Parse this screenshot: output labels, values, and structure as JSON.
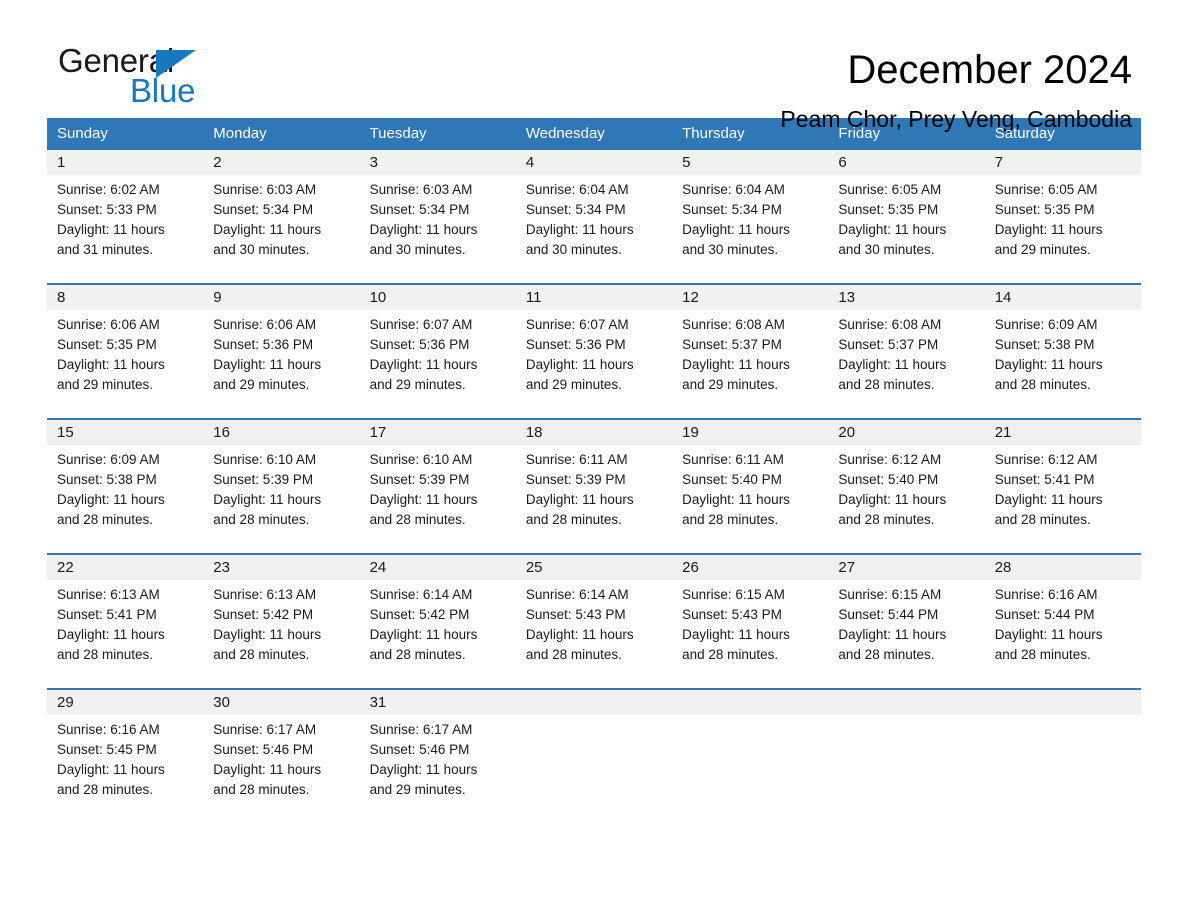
{
  "brand": {
    "name_part1": "General",
    "name_part2": "Blue",
    "accent_color": "#1878bd"
  },
  "header": {
    "title": "December 2024",
    "subtitle": "Peam Chor, Prey Veng, Cambodia"
  },
  "calendar": {
    "header_color": "#3077b5",
    "daynum_bg": "#f1f1f1",
    "weekdays": [
      "Sunday",
      "Monday",
      "Tuesday",
      "Wednesday",
      "Thursday",
      "Friday",
      "Saturday"
    ],
    "weeks": [
      {
        "days": [
          {
            "num": "1",
            "sunrise": "Sunrise: 6:02 AM",
            "sunset": "Sunset: 5:33 PM",
            "daylight_l1": "Daylight: 11 hours",
            "daylight_l2": "and 31 minutes."
          },
          {
            "num": "2",
            "sunrise": "Sunrise: 6:03 AM",
            "sunset": "Sunset: 5:34 PM",
            "daylight_l1": "Daylight: 11 hours",
            "daylight_l2": "and 30 minutes."
          },
          {
            "num": "3",
            "sunrise": "Sunrise: 6:03 AM",
            "sunset": "Sunset: 5:34 PM",
            "daylight_l1": "Daylight: 11 hours",
            "daylight_l2": "and 30 minutes."
          },
          {
            "num": "4",
            "sunrise": "Sunrise: 6:04 AM",
            "sunset": "Sunset: 5:34 PM",
            "daylight_l1": "Daylight: 11 hours",
            "daylight_l2": "and 30 minutes."
          },
          {
            "num": "5",
            "sunrise": "Sunrise: 6:04 AM",
            "sunset": "Sunset: 5:34 PM",
            "daylight_l1": "Daylight: 11 hours",
            "daylight_l2": "and 30 minutes."
          },
          {
            "num": "6",
            "sunrise": "Sunrise: 6:05 AM",
            "sunset": "Sunset: 5:35 PM",
            "daylight_l1": "Daylight: 11 hours",
            "daylight_l2": "and 30 minutes."
          },
          {
            "num": "7",
            "sunrise": "Sunrise: 6:05 AM",
            "sunset": "Sunset: 5:35 PM",
            "daylight_l1": "Daylight: 11 hours",
            "daylight_l2": "and 29 minutes."
          }
        ]
      },
      {
        "days": [
          {
            "num": "8",
            "sunrise": "Sunrise: 6:06 AM",
            "sunset": "Sunset: 5:35 PM",
            "daylight_l1": "Daylight: 11 hours",
            "daylight_l2": "and 29 minutes."
          },
          {
            "num": "9",
            "sunrise": "Sunrise: 6:06 AM",
            "sunset": "Sunset: 5:36 PM",
            "daylight_l1": "Daylight: 11 hours",
            "daylight_l2": "and 29 minutes."
          },
          {
            "num": "10",
            "sunrise": "Sunrise: 6:07 AM",
            "sunset": "Sunset: 5:36 PM",
            "daylight_l1": "Daylight: 11 hours",
            "daylight_l2": "and 29 minutes."
          },
          {
            "num": "11",
            "sunrise": "Sunrise: 6:07 AM",
            "sunset": "Sunset: 5:36 PM",
            "daylight_l1": "Daylight: 11 hours",
            "daylight_l2": "and 29 minutes."
          },
          {
            "num": "12",
            "sunrise": "Sunrise: 6:08 AM",
            "sunset": "Sunset: 5:37 PM",
            "daylight_l1": "Daylight: 11 hours",
            "daylight_l2": "and 29 minutes."
          },
          {
            "num": "13",
            "sunrise": "Sunrise: 6:08 AM",
            "sunset": "Sunset: 5:37 PM",
            "daylight_l1": "Daylight: 11 hours",
            "daylight_l2": "and 28 minutes."
          },
          {
            "num": "14",
            "sunrise": "Sunrise: 6:09 AM",
            "sunset": "Sunset: 5:38 PM",
            "daylight_l1": "Daylight: 11 hours",
            "daylight_l2": "and 28 minutes."
          }
        ]
      },
      {
        "days": [
          {
            "num": "15",
            "sunrise": "Sunrise: 6:09 AM",
            "sunset": "Sunset: 5:38 PM",
            "daylight_l1": "Daylight: 11 hours",
            "daylight_l2": "and 28 minutes."
          },
          {
            "num": "16",
            "sunrise": "Sunrise: 6:10 AM",
            "sunset": "Sunset: 5:39 PM",
            "daylight_l1": "Daylight: 11 hours",
            "daylight_l2": "and 28 minutes."
          },
          {
            "num": "17",
            "sunrise": "Sunrise: 6:10 AM",
            "sunset": "Sunset: 5:39 PM",
            "daylight_l1": "Daylight: 11 hours",
            "daylight_l2": "and 28 minutes."
          },
          {
            "num": "18",
            "sunrise": "Sunrise: 6:11 AM",
            "sunset": "Sunset: 5:39 PM",
            "daylight_l1": "Daylight: 11 hours",
            "daylight_l2": "and 28 minutes."
          },
          {
            "num": "19",
            "sunrise": "Sunrise: 6:11 AM",
            "sunset": "Sunset: 5:40 PM",
            "daylight_l1": "Daylight: 11 hours",
            "daylight_l2": "and 28 minutes."
          },
          {
            "num": "20",
            "sunrise": "Sunrise: 6:12 AM",
            "sunset": "Sunset: 5:40 PM",
            "daylight_l1": "Daylight: 11 hours",
            "daylight_l2": "and 28 minutes."
          },
          {
            "num": "21",
            "sunrise": "Sunrise: 6:12 AM",
            "sunset": "Sunset: 5:41 PM",
            "daylight_l1": "Daylight: 11 hours",
            "daylight_l2": "and 28 minutes."
          }
        ]
      },
      {
        "days": [
          {
            "num": "22",
            "sunrise": "Sunrise: 6:13 AM",
            "sunset": "Sunset: 5:41 PM",
            "daylight_l1": "Daylight: 11 hours",
            "daylight_l2": "and 28 minutes."
          },
          {
            "num": "23",
            "sunrise": "Sunrise: 6:13 AM",
            "sunset": "Sunset: 5:42 PM",
            "daylight_l1": "Daylight: 11 hours",
            "daylight_l2": "and 28 minutes."
          },
          {
            "num": "24",
            "sunrise": "Sunrise: 6:14 AM",
            "sunset": "Sunset: 5:42 PM",
            "daylight_l1": "Daylight: 11 hours",
            "daylight_l2": "and 28 minutes."
          },
          {
            "num": "25",
            "sunrise": "Sunrise: 6:14 AM",
            "sunset": "Sunset: 5:43 PM",
            "daylight_l1": "Daylight: 11 hours",
            "daylight_l2": "and 28 minutes."
          },
          {
            "num": "26",
            "sunrise": "Sunrise: 6:15 AM",
            "sunset": "Sunset: 5:43 PM",
            "daylight_l1": "Daylight: 11 hours",
            "daylight_l2": "and 28 minutes."
          },
          {
            "num": "27",
            "sunrise": "Sunrise: 6:15 AM",
            "sunset": "Sunset: 5:44 PM",
            "daylight_l1": "Daylight: 11 hours",
            "daylight_l2": "and 28 minutes."
          },
          {
            "num": "28",
            "sunrise": "Sunrise: 6:16 AM",
            "sunset": "Sunset: 5:44 PM",
            "daylight_l1": "Daylight: 11 hours",
            "daylight_l2": "and 28 minutes."
          }
        ]
      },
      {
        "days": [
          {
            "num": "29",
            "sunrise": "Sunrise: 6:16 AM",
            "sunset": "Sunset: 5:45 PM",
            "daylight_l1": "Daylight: 11 hours",
            "daylight_l2": "and 28 minutes."
          },
          {
            "num": "30",
            "sunrise": "Sunrise: 6:17 AM",
            "sunset": "Sunset: 5:46 PM",
            "daylight_l1": "Daylight: 11 hours",
            "daylight_l2": "and 28 minutes."
          },
          {
            "num": "31",
            "sunrise": "Sunrise: 6:17 AM",
            "sunset": "Sunset: 5:46 PM",
            "daylight_l1": "Daylight: 11 hours",
            "daylight_l2": "and 29 minutes."
          },
          {
            "num": "",
            "sunrise": "",
            "sunset": "",
            "daylight_l1": "",
            "daylight_l2": ""
          },
          {
            "num": "",
            "sunrise": "",
            "sunset": "",
            "daylight_l1": "",
            "daylight_l2": ""
          },
          {
            "num": "",
            "sunrise": "",
            "sunset": "",
            "daylight_l1": "",
            "daylight_l2": ""
          },
          {
            "num": "",
            "sunrise": "",
            "sunset": "",
            "daylight_l1": "",
            "daylight_l2": ""
          }
        ]
      }
    ]
  }
}
